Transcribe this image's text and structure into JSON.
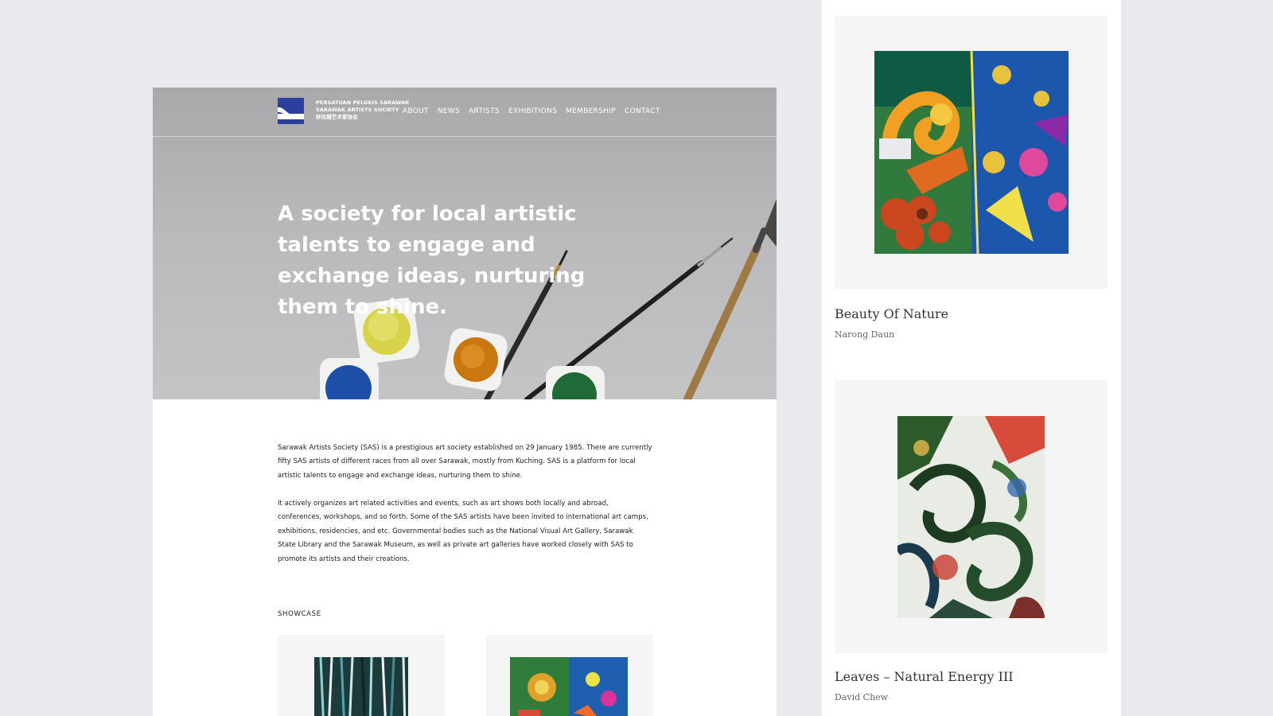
{
  "site": {
    "logo_lines": [
      "PERSATUAN PELUKIS SARAWAK",
      "SARAWAK ARTISTS SOCIETY",
      "砂拉越艺术家协会"
    ],
    "nav": [
      "ABOUT",
      "NEWS",
      "ARTISTS",
      "EXHIBITIONS",
      "MEMBERSHIP",
      "CONTACT"
    ]
  },
  "hero": {
    "title": "A society for local artistic talents to engage and exchange ideas, nurturing them to shine."
  },
  "about": {
    "paragraph1": "Sarawak Artists Society (SAS) is a prestigious art society established on 29 January 1985. There are currently fifty SAS artists of different races from all over Sarawak, mostly from Kuching. SAS is a platform for local artistic talents to engage and exchange ideas, nurturing them to shine.",
    "paragraph2": "It actively organizes art related activities and events, such as art shows both locally and abroad, conferences, workshops, and so forth. Some of the SAS artists have been invited to international art camps, exhibitions, residencies, and etc. Governmental bodies such as the National Visual Art Gallery, Sarawak State Library and the Sarawak Museum, as well as private art galleries have worked closely with SAS to promote its artists and their creations."
  },
  "showcase": {
    "heading": "SHOWCASE"
  },
  "artworks": [
    {
      "title": "Beauty Of Nature",
      "artist": "Narong Daun"
    },
    {
      "title": "Leaves – Natural Energy III",
      "artist": "David Chew"
    }
  ],
  "colors": {
    "page_bg": "#e8eaed",
    "card_bg": "#f5f5f5",
    "logo_blue": "#2a3f9e"
  }
}
